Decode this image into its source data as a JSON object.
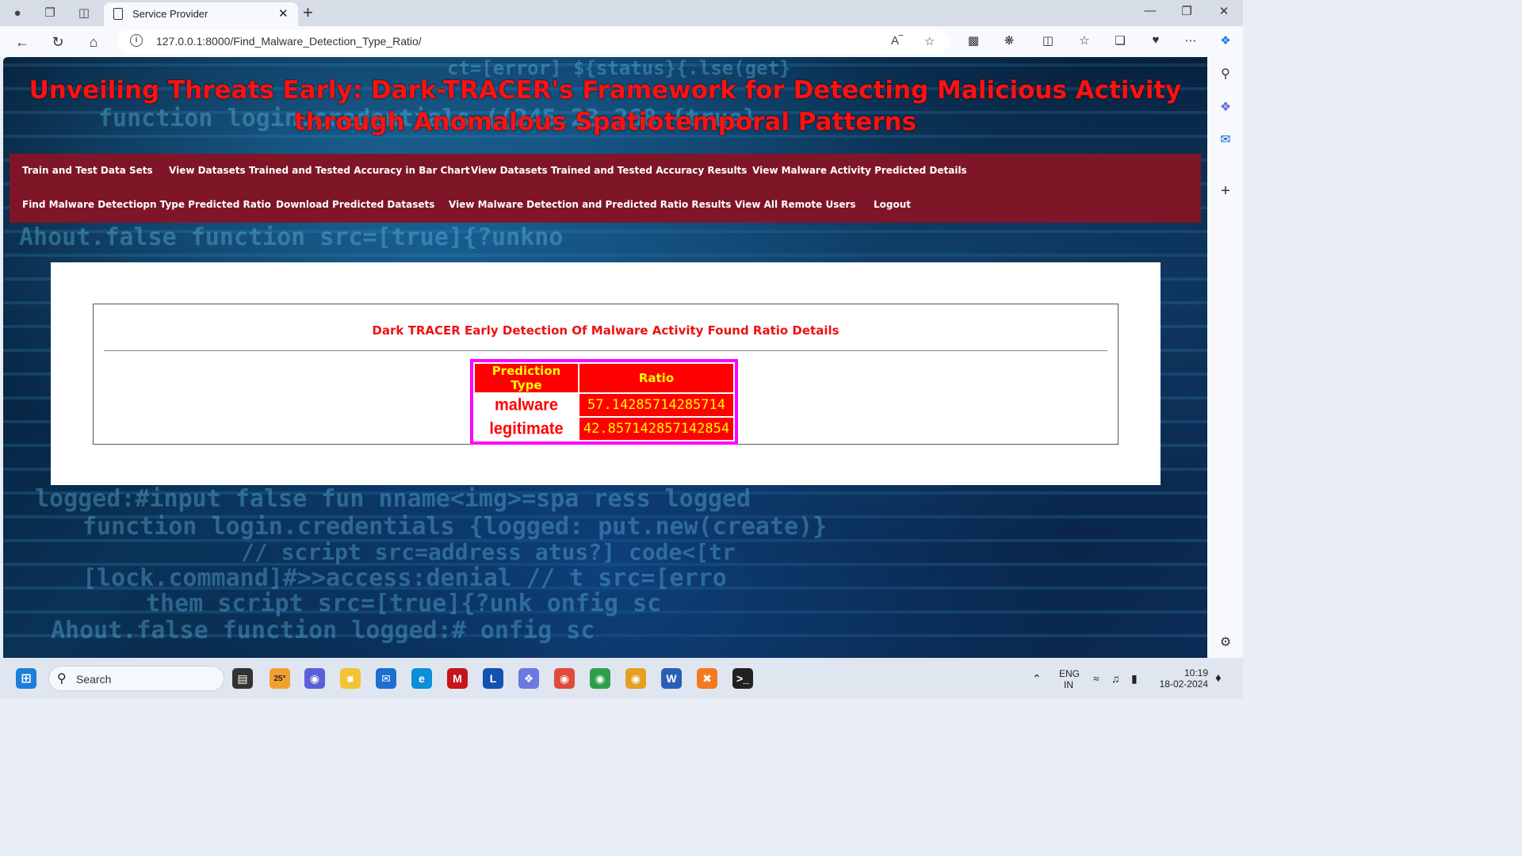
{
  "browser": {
    "tab_title": "Service Provider",
    "url": "127.0.0.1:8000/Find_Malware_Detection_Type_Ratio/"
  },
  "page": {
    "title": "Unveiling Threats Early: Dark-TRACER's Framework for Detecting Malicious Activity through Anomalous Spatiotemporal Patterns",
    "menu": [
      "Train and Test Data Sets",
      "View Datasets Trained and Tested Accuracy in Bar Chart",
      "View Datasets Trained and Tested Accuracy Results",
      "View Malware Activity Predicted Details",
      "Find Malware Detectiopn Type Predicted Ratio",
      "Download Predicted Datasets",
      "View Malware Detection and Predicted Ratio Results",
      "View All Remote Users",
      "Logout"
    ],
    "panel_title": "Dark TRACER Early Detection Of Malware Activity Found Ratio Details",
    "table": {
      "headers": [
        "Prediction Type",
        "Ratio"
      ],
      "rows": [
        {
          "type": "malware",
          "ratio": "57.14285714285714"
        },
        {
          "type": "legitimate",
          "ratio": "42.857142857142854"
        }
      ]
    },
    "colors": {
      "title": "#ff1111",
      "menu_bg": "#7e1627",
      "table_border": "#ff00ff",
      "cell_red": "#ff0000",
      "cell_yellow": "#ffff00"
    }
  },
  "taskbar": {
    "search_placeholder": "Search",
    "weather_temp": "25°",
    "lang_line1": "ENG",
    "lang_line2": "IN",
    "time": "10:19",
    "date": "18-02-2024"
  }
}
